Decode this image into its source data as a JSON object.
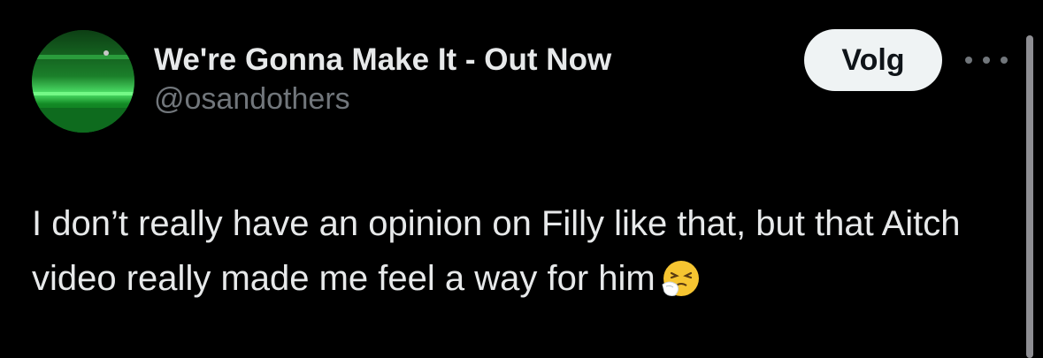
{
  "author": {
    "display_name": "We're Gonna Make It - Out Now",
    "handle": "@osandothers"
  },
  "follow_button": {
    "label": "Volg"
  },
  "more_button": {
    "icon": "more-horizontal-icon"
  },
  "tweet": {
    "text": "I don’t really have an opinion on Filly like that, but that Aitch video really made me feel a way for him",
    "emoji": "sneezing-face-emoji"
  },
  "colors": {
    "background": "#000000",
    "primary_text": "#e7e9ea",
    "secondary_text": "#71767b",
    "follow_button_bg": "#eff3f4",
    "follow_button_text": "#0f1419",
    "avatar_green": "#1fa833"
  }
}
